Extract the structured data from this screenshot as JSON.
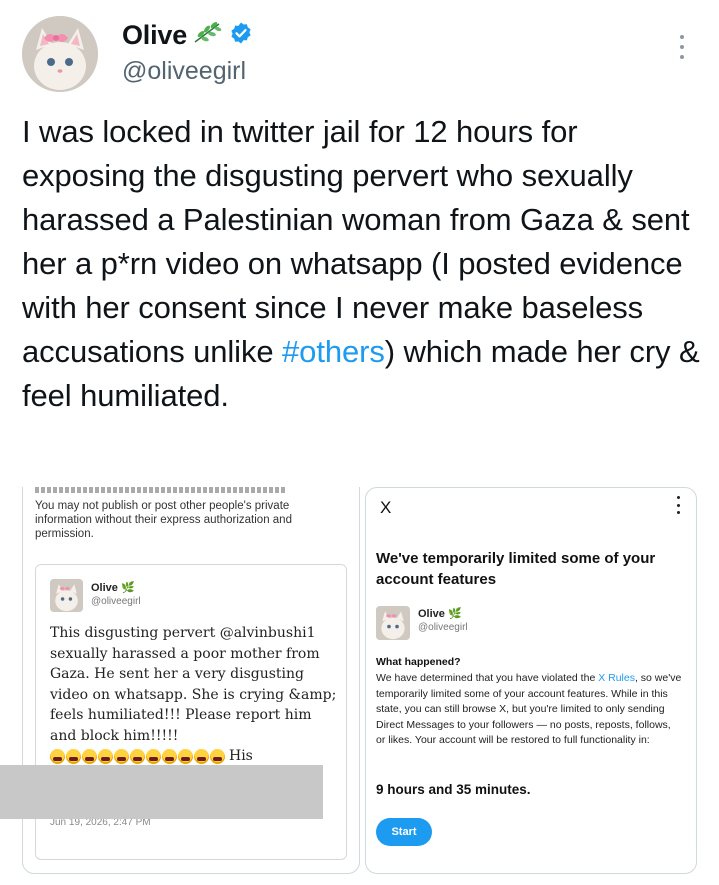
{
  "tweet": {
    "author": {
      "display_name": "Olive",
      "handle": "@oliveegirl",
      "verified": true,
      "leaf_icon": "herb-icon",
      "badge_color": "#1d9bf0"
    },
    "text_before_hashtag": "I was locked in twitter jail for 12 hours for exposing the disgusting pervert who sexually harassed a Palestinian woman from Gaza & sent her a p*rn video on whatsapp (I posted evidence with her consent since I never make baseless accusations unlike ",
    "hashtag": "#others",
    "text_after_hashtag": ") which made her cry & feel humiliated."
  },
  "left_screenshot": {
    "policy_text": "You may not publish or post other people's private information without their express authorization and permission.",
    "quoted": {
      "display_name": "Olive",
      "handle": "@oliveegirl",
      "text": "This disgusting pervert @alvinbushi1 sexually harassed a poor mother from Gaza. He sent her a very disgusting video on whatsapp. She is crying &amp; feels humiliated!!! Please report him and block him!!!!!",
      "emoji_count": 11,
      "after_emoji": "His",
      "date": "Jun 19, 2026, 2:47 PM"
    }
  },
  "right_screenshot": {
    "close_label": "X",
    "title": "We've temporarily limited some of your account features",
    "author_name": "Olive",
    "author_handle": "@oliveegirl",
    "heading": "What happened?",
    "body_before_link": "We have determined that you have violated the ",
    "link_text": "X Rules",
    "body_after_link": ", so we've temporarily limited some of your account features. While in this state, you can still browse X, but you're limited to only sending Direct Messages to your followers — no posts, reposts, follows, or likes. Your account will be restored to full functionality in:",
    "time_remaining": "9 hours and 35 minutes.",
    "start_label": "Start"
  },
  "colors": {
    "accent": "#1d9bf0",
    "text": "#0f1419",
    "muted": "#536471"
  }
}
